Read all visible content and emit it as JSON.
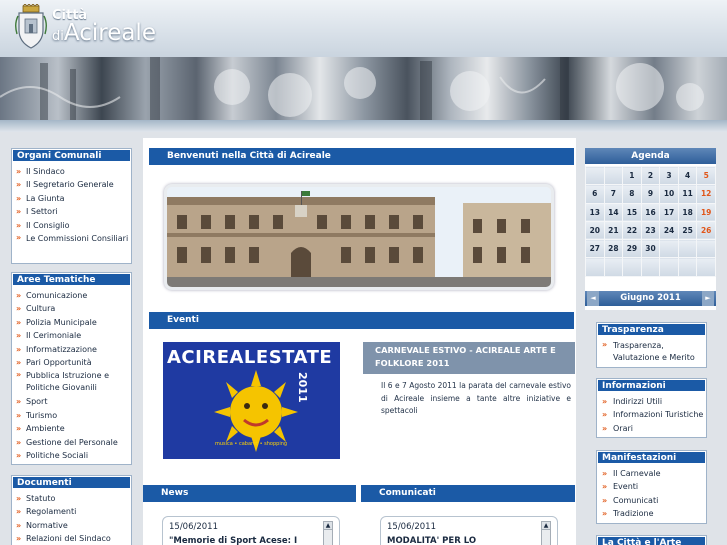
{
  "header": {
    "city_prefix": "Città",
    "city_di": "di",
    "city_name": "Acireale"
  },
  "left": {
    "organi": {
      "title": "Organi Comunali",
      "items": [
        "Il Sindaco",
        "Il Segretario Generale",
        "La Giunta",
        "I Settori",
        "Il Consiglio",
        "Le Commissioni Consiliari"
      ]
    },
    "aree": {
      "title": "Aree Tematiche",
      "items": [
        "Comunicazione",
        "Cultura",
        "Polizia Municipale",
        "Il Cerimoniale",
        "Informatizzazione",
        "Pari Opportunità",
        "Pubblica Istruzione e Politiche Giovanili",
        "Sport",
        "Turismo",
        "Ambiente",
        "Gestione del Personale",
        "Politiche Sociali"
      ]
    },
    "documenti": {
      "title": "Documenti",
      "items": [
        "Statuto",
        "Regolamenti",
        "Normative",
        "Relazioni del Sindaco"
      ]
    }
  },
  "center": {
    "welcome_title": "Benvenuti nella Città di Acireale",
    "eventi_title": "Eventi",
    "poster_text": "ACIREALESTATE",
    "poster_year": "2011",
    "poster_sub": "musica • cabaret • shopping",
    "event_headline": "CARNEVALE ESTIVO - ACIREALE ARTE E FOLKLORE 2011",
    "event_body": "Il 6 e 7 Agosto 2011 la parata del carnevale estivo di Acireale insieme a tante altre iniziative e spettacoli",
    "news": {
      "title": "News",
      "date": "15/06/2011",
      "headline": "\"Memorie di Sport Acese: I"
    },
    "comunicati": {
      "title": "Comunicati",
      "date": "15/06/2011",
      "headline": "MODALITA' PER LO"
    }
  },
  "agenda": {
    "title": "Agenda",
    "month": "Giugno 2011",
    "weeks": [
      [
        "",
        "",
        "1",
        "2",
        "3",
        "4",
        "5"
      ],
      [
        "6",
        "7",
        "8",
        "9",
        "10",
        "11",
        "12"
      ],
      [
        "13",
        "14",
        "15",
        "16",
        "17",
        "18",
        "19"
      ],
      [
        "20",
        "21",
        "22",
        "23",
        "24",
        "25",
        "26"
      ],
      [
        "27",
        "28",
        "29",
        "30",
        "",
        "",
        ""
      ],
      [
        "",
        "",
        "",
        "",
        "",
        "",
        ""
      ]
    ],
    "prev": "◄",
    "next": "►"
  },
  "right": {
    "trasparenza": {
      "title": "Trasparenza",
      "items": [
        "Trasparenza, Valutazione e Merito"
      ]
    },
    "informazioni": {
      "title": "Informazioni",
      "items": [
        "Indirizzi Utili",
        "Informazioni Turistiche",
        "Orari"
      ]
    },
    "manifestazioni": {
      "title": "Manifestazioni",
      "items": [
        "Il Carnevale",
        "Eventi",
        "Comunicati",
        "Tradizione"
      ]
    },
    "arte": {
      "title": "La Città e l'Arte"
    }
  },
  "colors": {
    "brand_blue": "#1b5aa6",
    "accent_orange": "#e05a1a"
  }
}
